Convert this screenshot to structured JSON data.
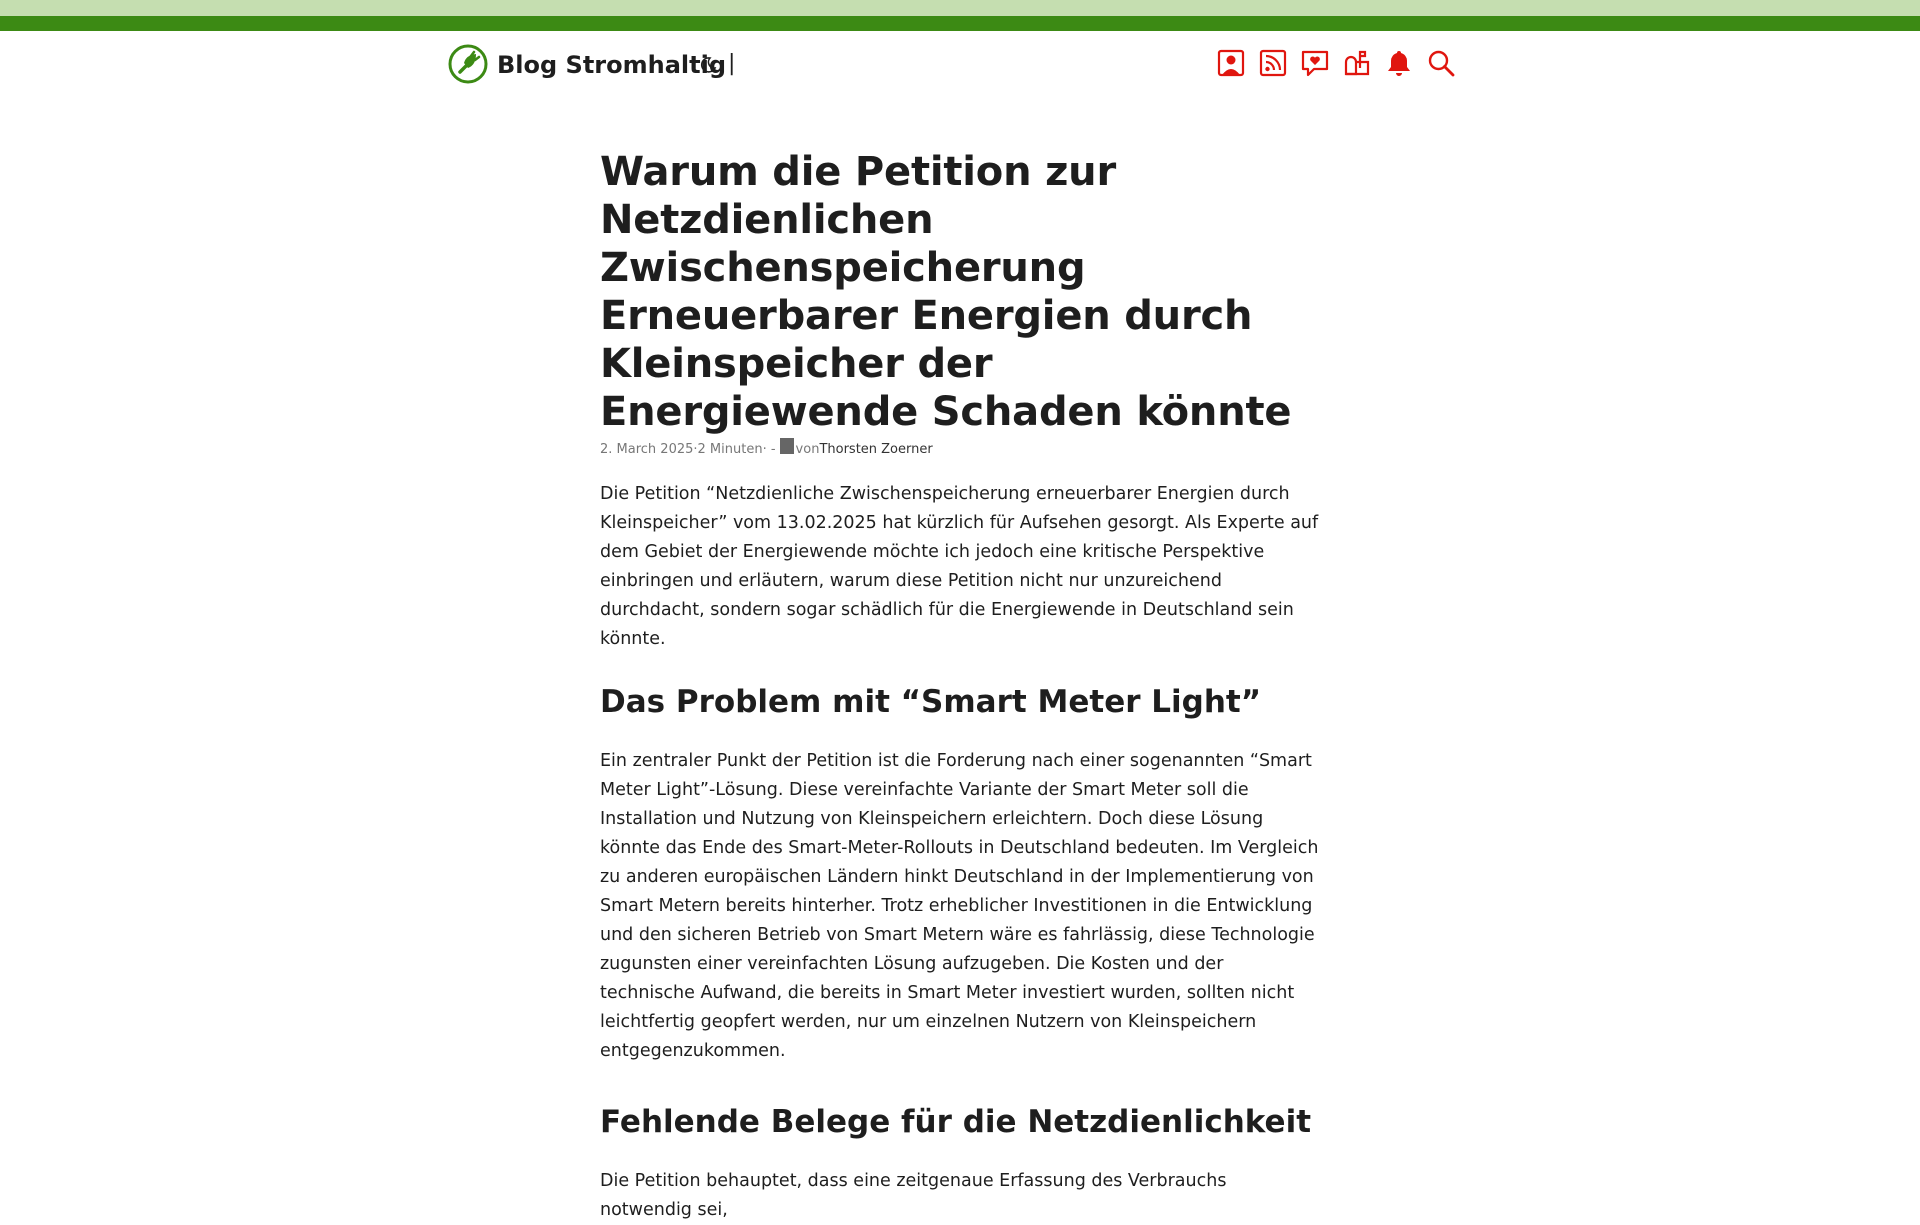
{
  "header": {
    "site_title": "Blog Stromhaltig",
    "separator": "|",
    "brand_color": "#3c8a14",
    "icon_color": "#e0160f",
    "logo_icon": "plug-leaf-icon",
    "theme_toggle_icon": "moon-icon",
    "nav_icons": [
      "user-profile-icon",
      "rss-feed-icon",
      "heart-chat-icon",
      "mailbox-icon",
      "bell-icon",
      "search-icon"
    ]
  },
  "article": {
    "title": "Warum die Petition zur Netzdienlichen Zwischenspeicherung Erneuerbarer Energien durch Kleinspeicher der Energiewende Schaden könnte",
    "meta": {
      "date": "2. March 2025",
      "sep1": " · ",
      "reading_time": "2 Minuten",
      "sep2": " · - ",
      "author_prefix": "von ",
      "author": "Thorsten Zoerner"
    },
    "paragraph_1": "Die Petition “Netzdienliche Zwischenspeicherung erneuerbarer Energien durch Kleinspeicher” vom 13.02.2025 hat kürzlich für Aufsehen gesorgt. Als Experte auf dem Gebiet der Energiewende möchte ich jedoch eine kritische Perspektive einbringen und erläutern, warum diese Petition nicht nur unzureichend durchdacht, sondern sogar schädlich für die Energiewende in Deutschland sein könnte.",
    "heading_1": "Das Problem mit “Smart Meter Light”",
    "paragraph_2": "Ein zentraler Punkt der Petition ist die Forderung nach einer sogenannten “Smart Meter Light”-Lösung. Diese vereinfachte Variante der Smart Meter soll die Installation und Nutzung von Kleinspeichern erleichtern. Doch diese Lösung könnte das Ende des Smart-Meter-Rollouts in Deutschland bedeuten. Im Vergleich zu anderen europäischen Ländern hinkt Deutschland in der Implementierung von Smart Metern bereits hinterher. Trotz erheblicher Investitionen in die Entwicklung und den sicheren Betrieb von Smart Metern wäre es fahrlässig, diese Technologie zugunsten einer vereinfachten Lösung aufzugeben. Die Kosten und der technische Aufwand, die bereits in Smart Meter investiert wurden, sollten nicht leichtfertig geopfert werden, nur um einzelnen Nutzern von Kleinspeichern entgegenzukommen.",
    "heading_2": "Fehlende Belege für die Netzdienlichkeit",
    "paragraph_3": "Die Petition behauptet, dass eine zeitgenaue Erfassung des Verbrauchs notwendig sei,"
  }
}
